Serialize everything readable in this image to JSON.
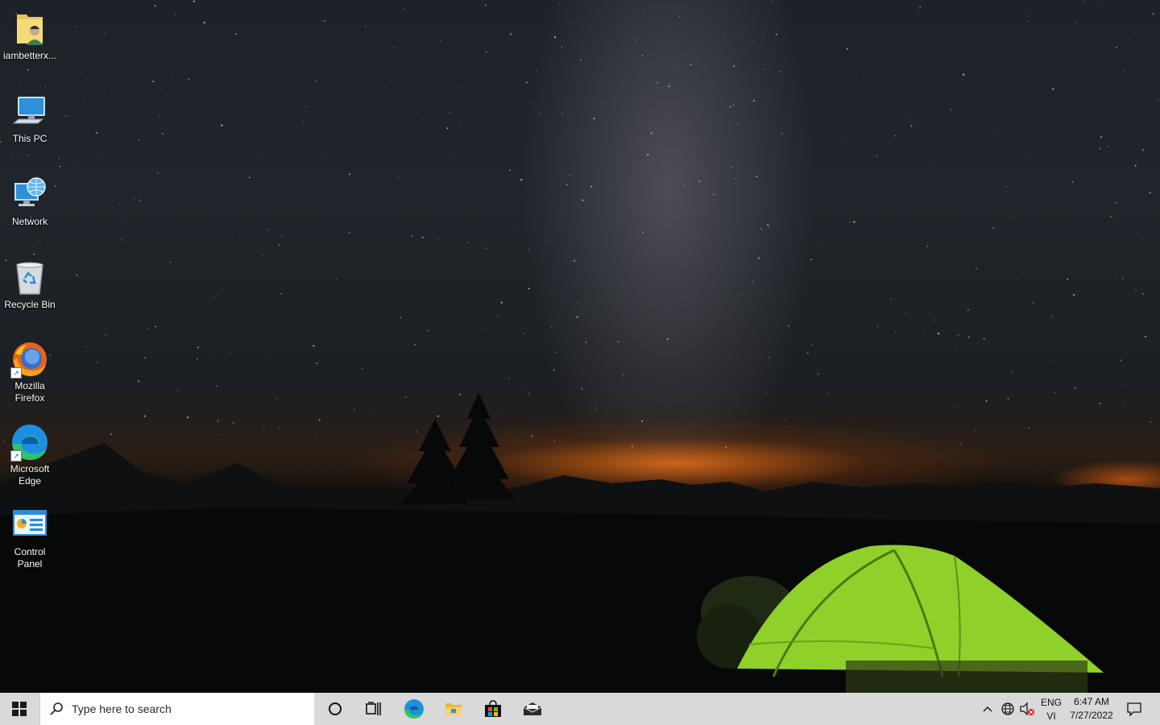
{
  "desktop": {
    "icons": [
      {
        "label": "iambetterx...",
        "icon": "user-folder-icon"
      },
      {
        "label": "This PC",
        "icon": "computer-icon"
      },
      {
        "label": "Network",
        "icon": "network-icon"
      },
      {
        "label": "Recycle Bin",
        "icon": "recycle-bin-icon"
      },
      {
        "label": "Mozilla Firefox",
        "icon": "firefox-icon"
      },
      {
        "label": "Microsoft Edge",
        "icon": "edge-icon"
      },
      {
        "label": "Control Panel",
        "icon": "control-panel-icon"
      }
    ]
  },
  "taskbar": {
    "search_placeholder": "Type here to search",
    "pinned": [
      "cortana-icon",
      "task-view-icon",
      "edge-icon",
      "file-explorer-icon",
      "store-icon",
      "mail-icon"
    ],
    "tray": {
      "language_top": "ENG",
      "language_bottom": "VI",
      "time": "6:47 AM",
      "date": "7/27/2022"
    }
  },
  "colors": {
    "taskbar_bg": "#d9d9d9",
    "windows_blue": "#0078d7",
    "tent_green": "#8fd12a"
  }
}
